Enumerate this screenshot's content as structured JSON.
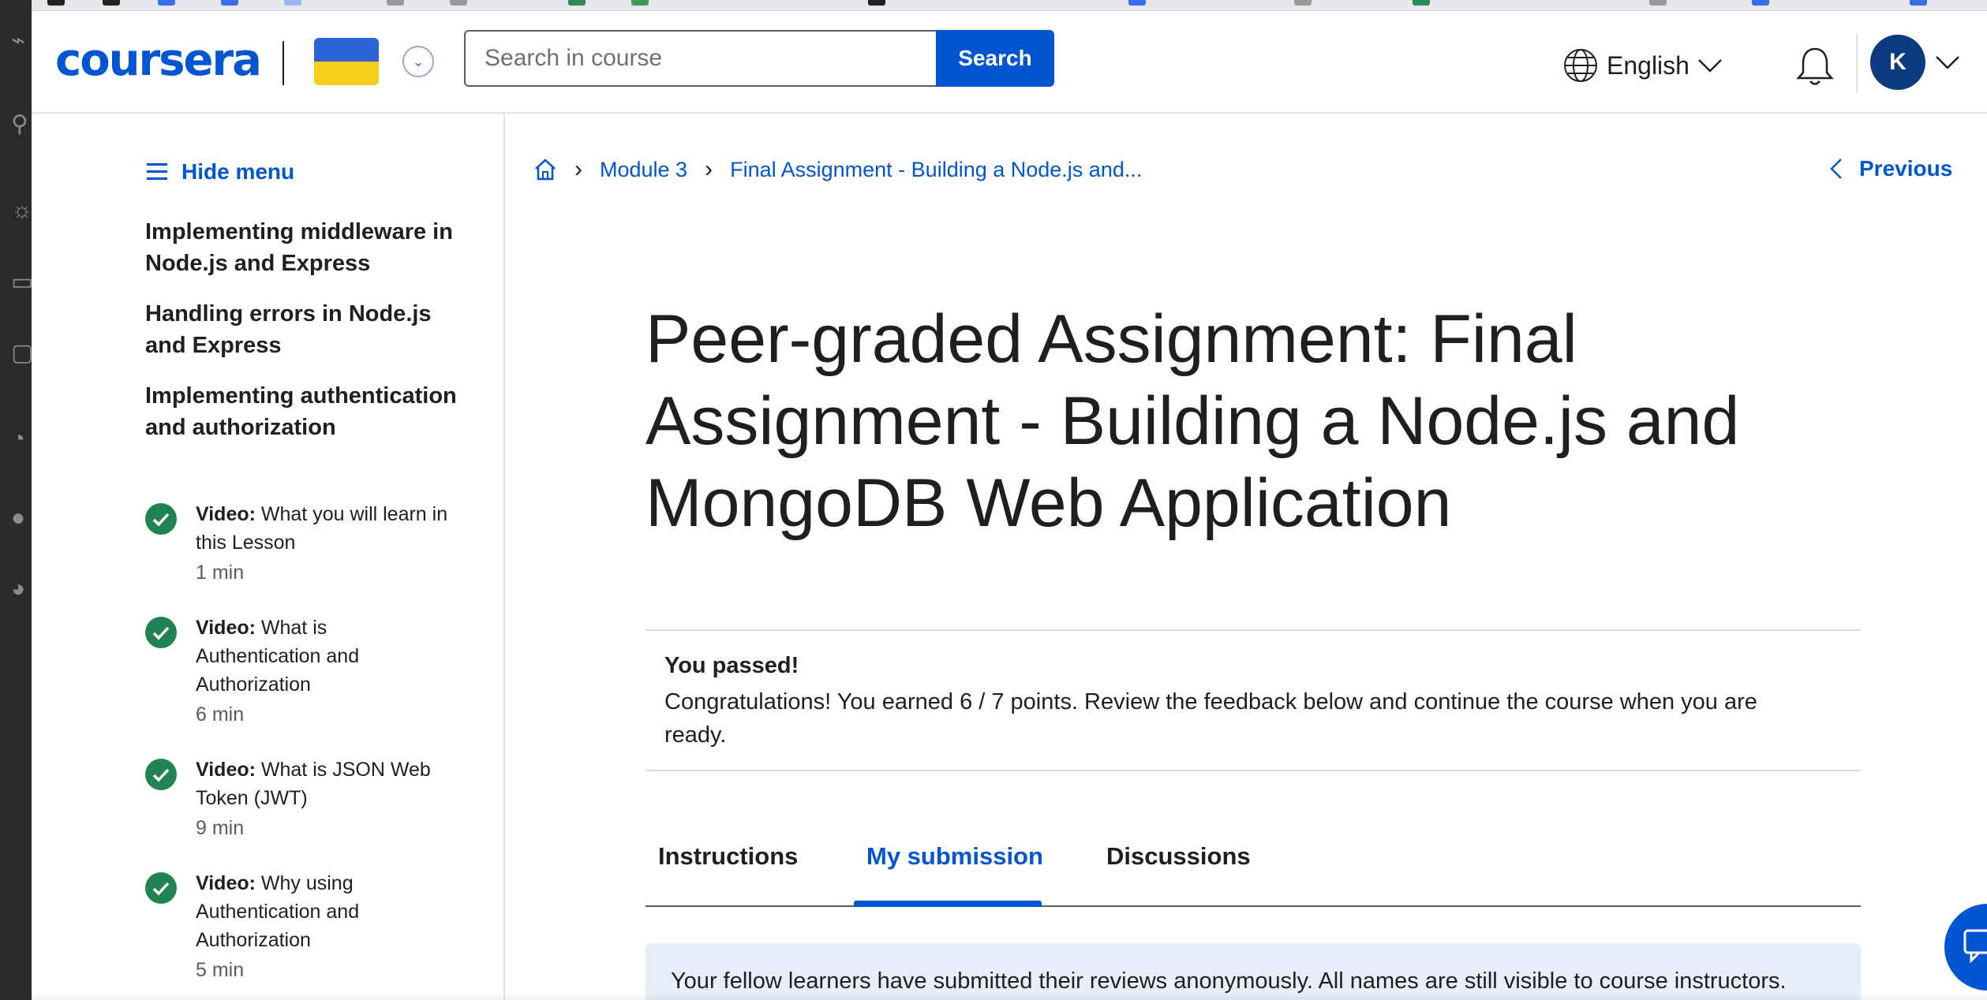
{
  "header": {
    "logo": "coursera",
    "search_placeholder": "Search in course",
    "search_button": "Search",
    "language": "English",
    "avatar_initial": "K"
  },
  "sidebar": {
    "hide_menu": "Hide menu",
    "sections": [
      "Implementing middleware in Node.js and Express",
      "Handling errors in Node.js and Express",
      "Implementing authentication and authorization"
    ],
    "items": [
      {
        "type": "Video:",
        "title": "What you will learn in this Lesson",
        "duration": "1 min"
      },
      {
        "type": "Video:",
        "title": "What is Authentication and Authorization",
        "duration": "6 min"
      },
      {
        "type": "Video:",
        "title": "What is JSON Web Token (JWT)",
        "duration": "9 min"
      },
      {
        "type": "Video:",
        "title": "Why using Authentication and Authorization",
        "duration": "5 min"
      }
    ]
  },
  "breadcrumb": {
    "module": "Module 3",
    "current": "Final Assignment - Building a Node.js and..."
  },
  "nav": {
    "previous": "Previous"
  },
  "main": {
    "title": "Peer-graded Assignment: Final Assignment - Building a Node.js and MongoDB Web Application",
    "notice_title": "You passed!",
    "notice_body": "Congratulations! You earned 6 / 7 points. Review the feedback below and continue the course when you are ready.",
    "tabs": [
      "Instructions",
      "My submission",
      "Discussions"
    ],
    "active_tab": "My submission",
    "review_note": "Your fellow learners have submitted their reviews anonymously. All names are still visible to course instructors."
  },
  "colors": {
    "brand": "#0056d2",
    "check": "#1f8354",
    "avatar": "#0b3a7e"
  }
}
